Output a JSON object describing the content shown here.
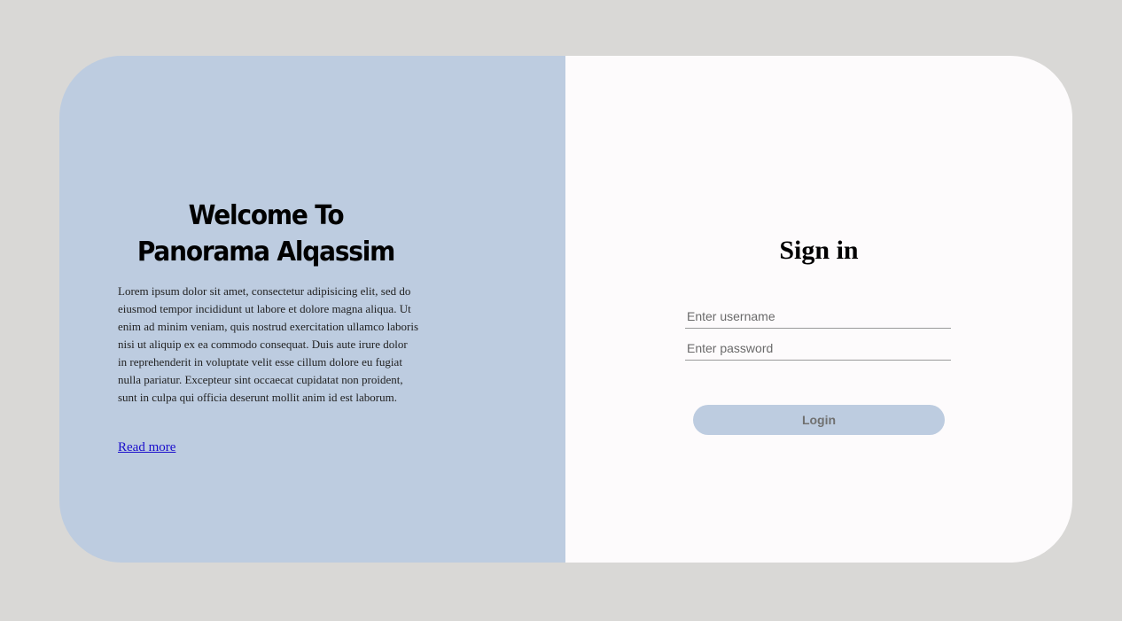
{
  "welcome": {
    "title_line1": "Welcome To",
    "title_line2": "Panorama Alqassim",
    "body": "Lorem ipsum dolor sit amet, consectetur adipisicing elit, sed do eiusmod tempor incididunt ut labore et dolore magna aliqua. Ut enim ad minim veniam, quis nostrud exercitation ullamco laboris nisi ut aliquip ex ea commodo consequat. Duis aute irure dolor in reprehenderit in voluptate velit esse cillum dolore eu fugiat nulla pariatur. Excepteur sint occaecat cupidatat non proident, sunt in culpa qui officia deserunt mollit anim id est laborum.",
    "read_more": "Read more"
  },
  "signin": {
    "title": "Sign in",
    "username_placeholder": "Enter username",
    "username_value": "",
    "password_placeholder": "Enter password",
    "password_value": "",
    "login_label": "Login"
  },
  "colors": {
    "page_background": "#d9d8d6",
    "left_panel": "#bdcce0",
    "right_panel": "#fdfbfc",
    "button": "#bdcce0",
    "link": "#1a0dcc"
  }
}
